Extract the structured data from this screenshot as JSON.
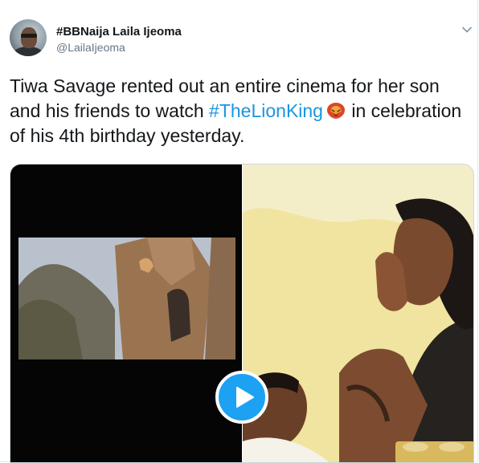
{
  "user": {
    "display_name": "#BBNaija Laila Ijeoma",
    "handle": "@LailaIjeoma"
  },
  "tweet": {
    "text_part1": "Tiwa Savage rented out an entire cinema for her son and his friends to watch ",
    "hashtag": "#TheLionKing",
    "text_part2": " in celebration of his 4th birthday yesterday."
  },
  "icons": {
    "menu": "chevron-down-icon",
    "emoji": "lion-emoji-icon",
    "play": "play-icon"
  },
  "colors": {
    "link": "#1b95e0",
    "play_button": "#1da1f2",
    "secondary_text": "#657786"
  }
}
